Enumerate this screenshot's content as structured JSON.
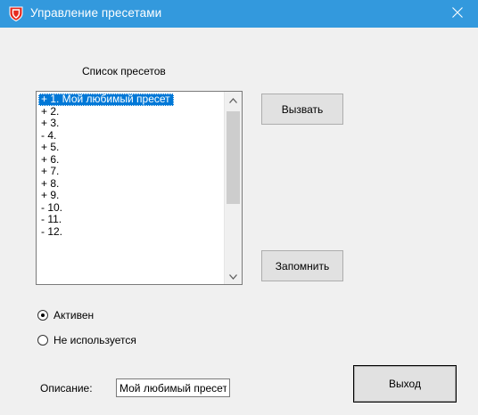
{
  "window": {
    "title": "Управление пресетами",
    "colors": {
      "titlebar": "#3399dd",
      "background": "#f0f0f0",
      "selection": "#0078d7"
    }
  },
  "presets": {
    "heading": "Список пресетов",
    "items": [
      {
        "label": "+ 1. Мой любимый пресет",
        "selected": true
      },
      {
        "label": "+ 2."
      },
      {
        "label": "+ 3."
      },
      {
        "label": "- 4."
      },
      {
        "label": "+ 5."
      },
      {
        "label": "+ 6."
      },
      {
        "label": "+ 7."
      },
      {
        "label": "+ 8."
      },
      {
        "label": "+ 9."
      },
      {
        "label": "- 10."
      },
      {
        "label": "- 11."
      },
      {
        "label": "- 12."
      }
    ]
  },
  "buttons": {
    "recall": "Вызвать",
    "store": "Запомнить",
    "exit": "Выход"
  },
  "status": {
    "active_label": "Активен",
    "unused_label": "Не используется",
    "selected": "active"
  },
  "description": {
    "label": "Описание:",
    "value": "Мой любимый пресет"
  },
  "icons": {
    "app": "shield-icon",
    "close": "close-icon",
    "scroll_up": "chevron-up-icon",
    "scroll_down": "chevron-down-icon"
  }
}
